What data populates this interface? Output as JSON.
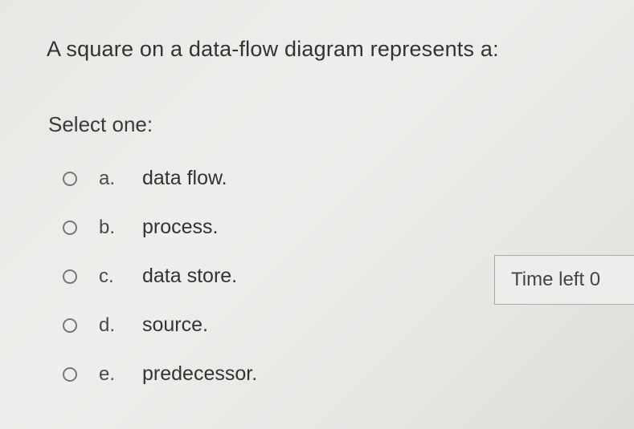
{
  "question": {
    "text": "A square on a data-flow diagram represents a:"
  },
  "prompt": "Select one:",
  "answers": [
    {
      "letter": "a.",
      "text": "data flow."
    },
    {
      "letter": "b.",
      "text": "process."
    },
    {
      "letter": "c.",
      "text": "data store."
    },
    {
      "letter": "d.",
      "text": "source."
    },
    {
      "letter": "e.",
      "text": "predecessor."
    }
  ],
  "timer": {
    "label": "Time left 0"
  }
}
